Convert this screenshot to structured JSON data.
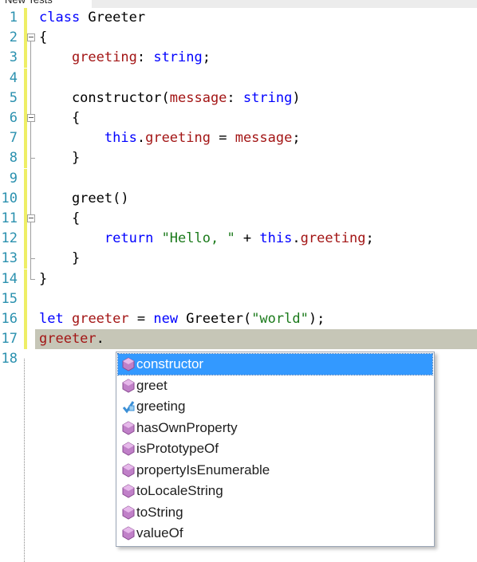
{
  "window": {
    "tab_title": "New Tests"
  },
  "editor": {
    "lines": [
      {
        "num": "1",
        "tokens": [
          {
            "t": "kw",
            "v": "class"
          },
          {
            "t": "",
            "v": " Greeter"
          }
        ]
      },
      {
        "num": "2",
        "tokens": [
          {
            "t": "",
            "v": "{"
          }
        ]
      },
      {
        "num": "3",
        "tokens": [
          {
            "t": "",
            "v": "    "
          },
          {
            "t": "prop",
            "v": "greeting"
          },
          {
            "t": "",
            "v": ": "
          },
          {
            "t": "type",
            "v": "string"
          },
          {
            "t": "",
            "v": ";"
          }
        ]
      },
      {
        "num": "4",
        "tokens": []
      },
      {
        "num": "5",
        "tokens": [
          {
            "t": "",
            "v": "    constructor("
          },
          {
            "t": "prop",
            "v": "message"
          },
          {
            "t": "",
            "v": ": "
          },
          {
            "t": "type",
            "v": "string"
          },
          {
            "t": "",
            "v": ")"
          }
        ]
      },
      {
        "num": "6",
        "tokens": [
          {
            "t": "",
            "v": "    {"
          }
        ]
      },
      {
        "num": "7",
        "tokens": [
          {
            "t": "",
            "v": "        "
          },
          {
            "t": "kw",
            "v": "this"
          },
          {
            "t": "",
            "v": "."
          },
          {
            "t": "prop",
            "v": "greeting"
          },
          {
            "t": "",
            "v": " = "
          },
          {
            "t": "prop",
            "v": "message"
          },
          {
            "t": "",
            "v": ";"
          }
        ]
      },
      {
        "num": "8",
        "tokens": [
          {
            "t": "",
            "v": "    }"
          }
        ]
      },
      {
        "num": "9",
        "tokens": []
      },
      {
        "num": "10",
        "tokens": [
          {
            "t": "",
            "v": "    greet()"
          }
        ]
      },
      {
        "num": "11",
        "tokens": [
          {
            "t": "",
            "v": "    {"
          }
        ]
      },
      {
        "num": "12",
        "tokens": [
          {
            "t": "",
            "v": "        "
          },
          {
            "t": "kw",
            "v": "return"
          },
          {
            "t": "",
            "v": " "
          },
          {
            "t": "strg",
            "v": "\"Hello, \""
          },
          {
            "t": "",
            "v": " + "
          },
          {
            "t": "kw",
            "v": "this"
          },
          {
            "t": "",
            "v": "."
          },
          {
            "t": "prop",
            "v": "greeting"
          },
          {
            "t": "",
            "v": ";"
          }
        ]
      },
      {
        "num": "13",
        "tokens": [
          {
            "t": "",
            "v": "    }"
          }
        ]
      },
      {
        "num": "14",
        "tokens": [
          {
            "t": "",
            "v": "}"
          }
        ]
      },
      {
        "num": "15",
        "tokens": []
      },
      {
        "num": "16",
        "tokens": [
          {
            "t": "kw",
            "v": "let"
          },
          {
            "t": "",
            "v": " "
          },
          {
            "t": "prop",
            "v": "greeter"
          },
          {
            "t": "",
            "v": " = "
          },
          {
            "t": "kw",
            "v": "new"
          },
          {
            "t": "",
            "v": " Greeter("
          },
          {
            "t": "strg",
            "v": "\"world\""
          },
          {
            "t": "",
            "v": ");"
          }
        ]
      },
      {
        "num": "17",
        "tokens": [
          {
            "t": "prop",
            "v": "greeter"
          },
          {
            "t": "",
            "v": "."
          }
        ]
      },
      {
        "num": "18",
        "tokens": []
      }
    ],
    "current_line": 17,
    "colors": {
      "keyword": "#0000ff",
      "identifier": "#a31515",
      "string": "#1b7a1b",
      "line_number": "#2b91af",
      "current_line_bg": "#c6c6b7",
      "change_bar": "#eeee66"
    }
  },
  "completion": {
    "items": [
      {
        "label": "constructor",
        "icon": "method-icon",
        "selected": true
      },
      {
        "label": "greet",
        "icon": "method-icon",
        "selected": false
      },
      {
        "label": "greeting",
        "icon": "property-icon",
        "selected": false
      },
      {
        "label": "hasOwnProperty",
        "icon": "method-icon",
        "selected": false
      },
      {
        "label": "isPrototypeOf",
        "icon": "method-icon",
        "selected": false
      },
      {
        "label": "propertyIsEnumerable",
        "icon": "method-icon",
        "selected": false
      },
      {
        "label": "toLocaleString",
        "icon": "method-icon",
        "selected": false
      },
      {
        "label": "toString",
        "icon": "method-icon",
        "selected": false
      },
      {
        "label": "valueOf",
        "icon": "method-icon",
        "selected": false
      }
    ],
    "colors": {
      "selected_bg": "#3399ff",
      "method_icon": "#c080c8",
      "property_icon": "#3b8fd6"
    }
  }
}
